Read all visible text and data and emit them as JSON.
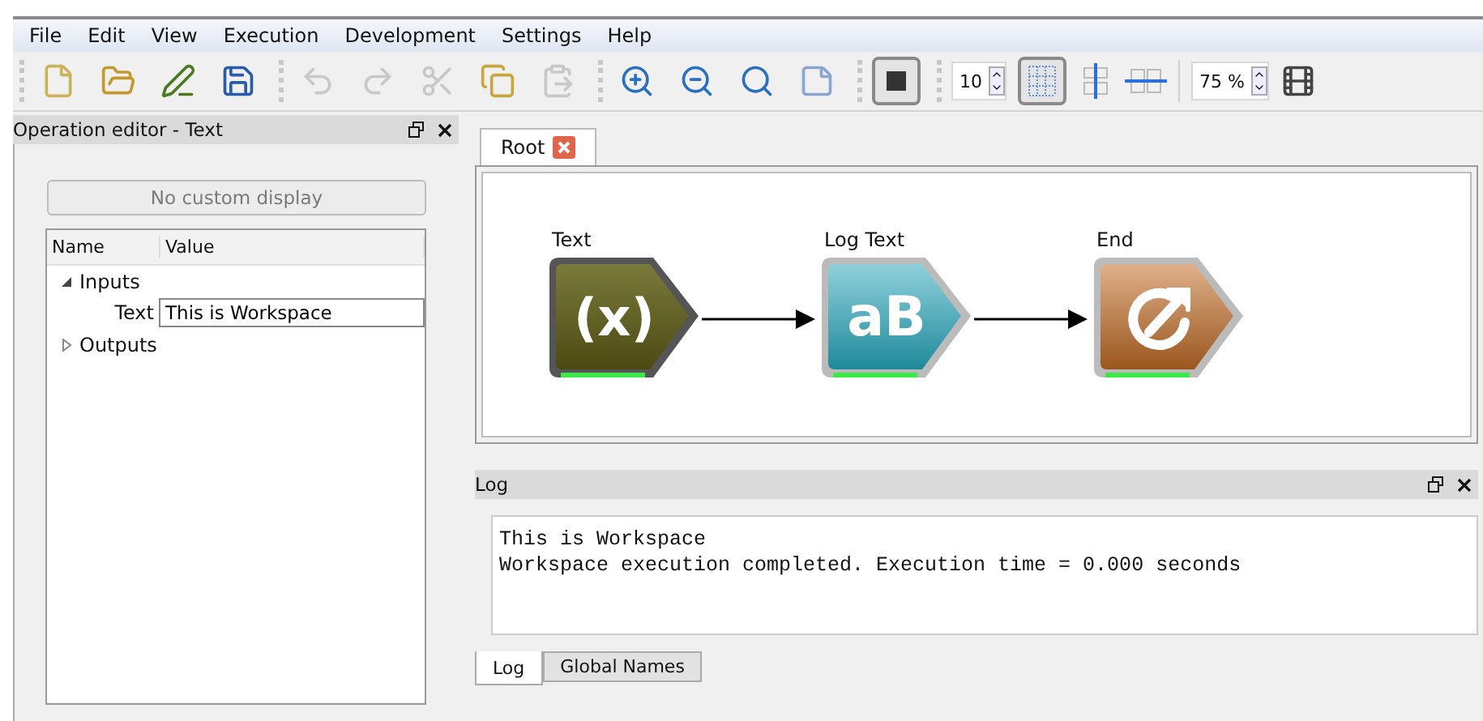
{
  "menu": [
    "File",
    "Edit",
    "View",
    "Execution",
    "Development",
    "Settings",
    "Help"
  ],
  "toolbar": {
    "groups": [
      [
        {
          "kind": "new",
          "disabled": false
        },
        {
          "kind": "open",
          "disabled": false
        },
        {
          "kind": "edit",
          "disabled": false
        },
        {
          "kind": "save",
          "disabled": false
        }
      ],
      [
        {
          "kind": "undo",
          "disabled": true
        },
        {
          "kind": "redo",
          "disabled": true
        },
        {
          "kind": "cut",
          "disabled": true
        },
        {
          "kind": "copy",
          "disabled": false
        },
        {
          "kind": "paste",
          "disabled": true
        }
      ],
      [
        {
          "kind": "zoom-in",
          "disabled": false
        },
        {
          "kind": "zoom-out",
          "disabled": false
        },
        {
          "kind": "zoom-fit",
          "disabled": false
        },
        {
          "kind": "page",
          "disabled": false
        }
      ]
    ],
    "stop": {
      "pressed": true
    },
    "grid_size": "10",
    "grid": {
      "pressed": true
    },
    "zoom": "75 %"
  },
  "operation_editor": {
    "title": "Operation editor - Text",
    "display_button": "No custom display",
    "columns": [
      "Name",
      "Value"
    ],
    "tree": [
      {
        "name": "Inputs",
        "expanded": true,
        "children": [
          {
            "name": "Text",
            "value": "This is Workspace"
          }
        ]
      },
      {
        "name": "Outputs",
        "expanded": false
      }
    ]
  },
  "workspace": {
    "tabs": [
      {
        "label": "Root",
        "selected": true
      }
    ],
    "nodes": [
      {
        "label": "Text",
        "kind": "variable",
        "glyph": "(x)"
      },
      {
        "label": "Log Text",
        "kind": "log",
        "glyph": "aB"
      },
      {
        "label": "End",
        "kind": "end"
      }
    ]
  },
  "log": {
    "title": "Log",
    "lines": [
      "This is Workspace",
      "Workspace execution completed. Execution time = 0.000 seconds"
    ],
    "tabs": [
      {
        "label": "Log",
        "selected": true
      },
      {
        "label": "Global Names",
        "selected": false
      }
    ]
  }
}
